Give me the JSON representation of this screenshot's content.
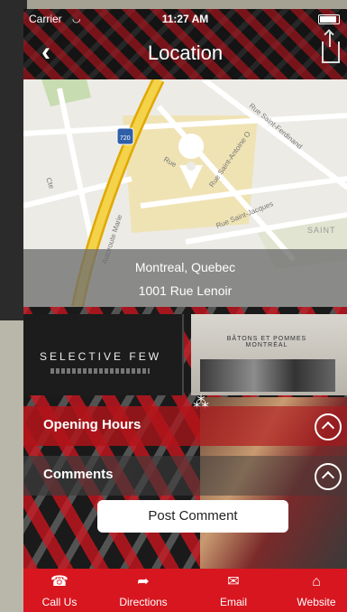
{
  "status_bar": {
    "carrier": "Carrier",
    "time": "11:27 AM"
  },
  "nav": {
    "title": "Location",
    "back_icon": "chevron-left-icon",
    "share_icon": "share-icon"
  },
  "map": {
    "labels": [
      "Rue Saint-Ferdinand",
      "Rue Saint-Antoine O",
      "Rue Saint-Jacques",
      "Rue",
      "Autoroute Marie",
      "SAINT",
      "Cte",
      "720"
    ],
    "city": "Montreal, Quebec",
    "address": "1001 Rue Lenoir"
  },
  "banners": {
    "left_title": "SELECTIVE FEW",
    "right_title": "BÂTONS ET POMMES MONTRÉAL"
  },
  "sections": [
    {
      "label": "Opening Hours",
      "icon": "chevron-up-icon"
    },
    {
      "label": "Comments",
      "icon": "chevron-up-icon"
    }
  ],
  "post_comment_label": "Post Comment",
  "tabbar": [
    {
      "label": "Call Us",
      "icon": "phone-icon"
    },
    {
      "label": "Directions",
      "icon": "directions-icon"
    },
    {
      "label": "Email",
      "icon": "email-icon"
    },
    {
      "label": "Website",
      "icon": "home-icon"
    }
  ],
  "colors": {
    "accent_red": "#d8161f",
    "highway_yellow": "#f1c534"
  }
}
